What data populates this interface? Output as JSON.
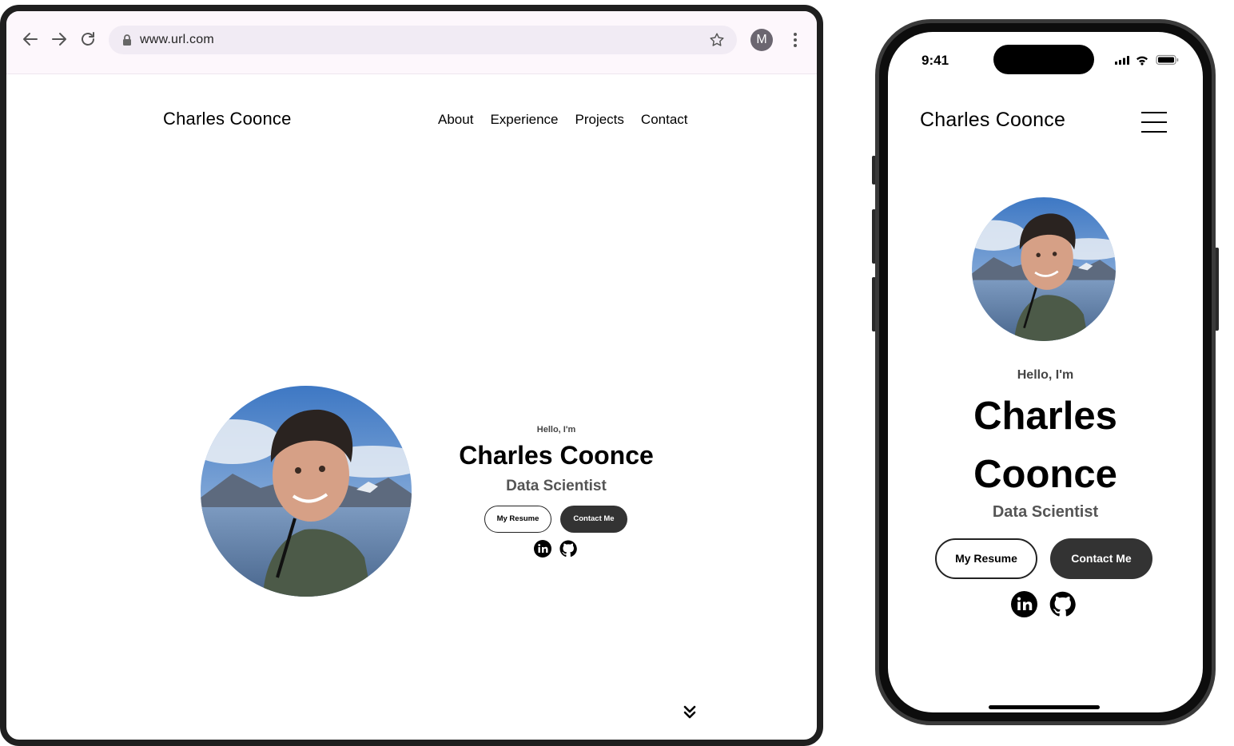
{
  "browser": {
    "url": "www.url.com",
    "profile_initial": "M",
    "icons": [
      "back-arrow-icon",
      "forward-arrow-icon",
      "reload-icon",
      "lock-icon",
      "star-icon",
      "kebab-menu-icon"
    ]
  },
  "site": {
    "brand": "Charles Coonce",
    "nav": [
      {
        "label": "About"
      },
      {
        "label": "Experience"
      },
      {
        "label": "Projects"
      },
      {
        "label": "Contact"
      }
    ],
    "hero": {
      "greeting": "Hello, I'm",
      "name": "Charles Coonce",
      "name_line1": "Charles",
      "name_line2": "Coonce",
      "role": "Data Scientist",
      "resume_button": "My Resume",
      "contact_button": "Contact Me",
      "social_icons": [
        "linkedin-icon",
        "github-icon"
      ],
      "scroll_icon": "double-chevron-down-icon"
    }
  },
  "phone": {
    "time": "9:41",
    "menu_icon": "hamburger-menu-icon"
  },
  "colors": {
    "dark_button": "#333333",
    "toolbar_bg": "#fdf7fc",
    "urlbar_bg": "#f1ebf4",
    "subtitle_gray": "#555555"
  }
}
